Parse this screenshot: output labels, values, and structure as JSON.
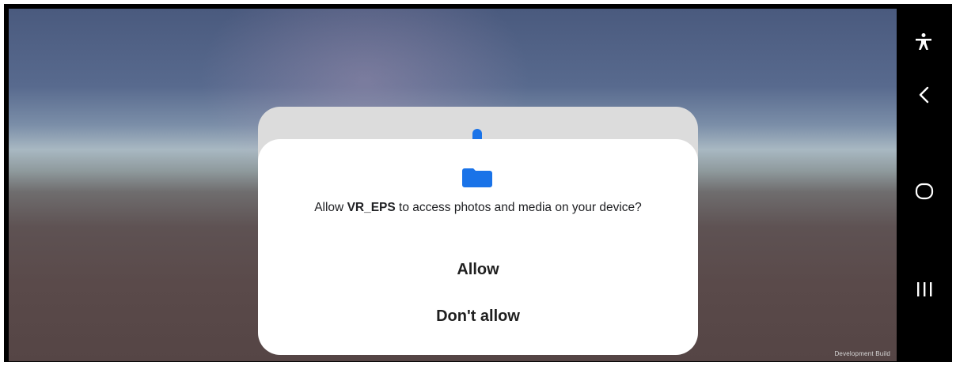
{
  "dialog": {
    "message_prefix": "Allow ",
    "app_name": "VR_EPS",
    "message_suffix": " to access photos and media on your device?",
    "allow_label": "Allow",
    "deny_label": "Don't allow",
    "icon": "folder-icon",
    "accent_color": "#1a73e8"
  },
  "scene": {
    "watermark": "Development Build"
  },
  "nav_bar": {
    "icons": [
      "accessibility-icon",
      "back-icon",
      "home-icon",
      "recents-icon"
    ]
  }
}
